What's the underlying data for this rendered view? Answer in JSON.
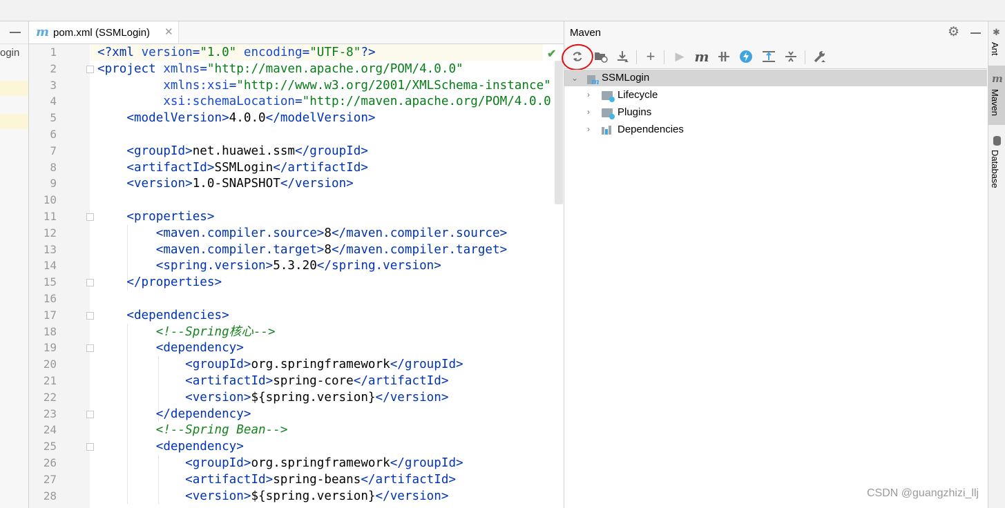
{
  "project": {
    "label": "ogin"
  },
  "tab": {
    "icon": "m",
    "title": "pom.xml (SSMLogin)",
    "close": "✕"
  },
  "line_numbers": [
    "1",
    "2",
    "3",
    "4",
    "5",
    "6",
    "7",
    "8",
    "9",
    "10",
    "11",
    "12",
    "13",
    "14",
    "15",
    "16",
    "17",
    "18",
    "19",
    "20",
    "21",
    "22",
    "23",
    "24",
    "25",
    "26",
    "27",
    "28"
  ],
  "maven": {
    "title": "Maven",
    "toolbar": [
      "reload-icon",
      "generate-sources-icon",
      "download-icon",
      "add-icon",
      "run-icon",
      "execute-goal-icon",
      "toggle-offline-icon",
      "skip-tests-icon",
      "show-dependencies-icon",
      "collapse-all-icon",
      "settings-wrench-icon"
    ],
    "tree": {
      "root": "SSMLogin",
      "children": [
        "Lifecycle",
        "Plugins",
        "Dependencies"
      ]
    }
  },
  "right_stripe": {
    "ant": "Ant",
    "maven": "Maven",
    "database": "Database"
  },
  "watermark": "CSDN @guangzhizi_llj",
  "colors": {
    "tag": "#0033b3",
    "string": "#067d17",
    "comment": "#15841e",
    "accent": "#5ba9e4"
  },
  "code_lines": [
    [
      [
        "t",
        "<?xml "
      ],
      [
        "a",
        "version"
      ],
      [
        "t",
        "="
      ],
      [
        "s",
        "\"1.0\""
      ],
      [
        "t",
        " "
      ],
      [
        "a",
        "encoding"
      ],
      [
        "t",
        "="
      ],
      [
        "s",
        "\"UTF-8\""
      ],
      [
        "t",
        "?>"
      ]
    ],
    [
      [
        "t",
        "<project "
      ],
      [
        "a",
        "xmlns"
      ],
      [
        "t",
        "="
      ],
      [
        "s",
        "\"http://maven.apache.org/POM/4.0.0\""
      ]
    ],
    [
      [
        "x",
        "         "
      ],
      [
        "a",
        "xmlns:xsi"
      ],
      [
        "t",
        "="
      ],
      [
        "s",
        "\"http://www.w3.org/2001/XMLSchema-instance\""
      ]
    ],
    [
      [
        "x",
        "         "
      ],
      [
        "a",
        "xsi:schemaLocation"
      ],
      [
        "t",
        "="
      ],
      [
        "s",
        "\"http://maven.apache.org/POM/4.0.0"
      ]
    ],
    [
      [
        "x",
        "    "
      ],
      [
        "t",
        "<modelVersion>"
      ],
      [
        "x",
        "4.0.0"
      ],
      [
        "t",
        "</modelVersion>"
      ]
    ],
    [
      [
        "x",
        ""
      ]
    ],
    [
      [
        "x",
        "    "
      ],
      [
        "t",
        "<groupId>"
      ],
      [
        "x",
        "net.huawei.ssm"
      ],
      [
        "t",
        "</groupId>"
      ]
    ],
    [
      [
        "x",
        "    "
      ],
      [
        "t",
        "<artifactId>"
      ],
      [
        "x",
        "SSMLogin"
      ],
      [
        "t",
        "</artifactId>"
      ]
    ],
    [
      [
        "x",
        "    "
      ],
      [
        "t",
        "<version>"
      ],
      [
        "x",
        "1.0-SNAPSHOT"
      ],
      [
        "t",
        "</version>"
      ]
    ],
    [
      [
        "x",
        ""
      ]
    ],
    [
      [
        "x",
        "    "
      ],
      [
        "t",
        "<properties>"
      ]
    ],
    [
      [
        "x",
        "        "
      ],
      [
        "t",
        "<maven.compiler.source>"
      ],
      [
        "x",
        "8"
      ],
      [
        "t",
        "</maven.compiler.source>"
      ]
    ],
    [
      [
        "x",
        "        "
      ],
      [
        "t",
        "<maven.compiler.target>"
      ],
      [
        "x",
        "8"
      ],
      [
        "t",
        "</maven.compiler.target>"
      ]
    ],
    [
      [
        "x",
        "        "
      ],
      [
        "t",
        "<spring.version>"
      ],
      [
        "x",
        "5.3.20"
      ],
      [
        "t",
        "</spring.version>"
      ]
    ],
    [
      [
        "x",
        "    "
      ],
      [
        "t",
        "</properties>"
      ]
    ],
    [
      [
        "x",
        ""
      ]
    ],
    [
      [
        "x",
        "    "
      ],
      [
        "t",
        "<dependencies>"
      ]
    ],
    [
      [
        "x",
        "        "
      ],
      [
        "c",
        "<!--Spring核心-->"
      ]
    ],
    [
      [
        "x",
        "        "
      ],
      [
        "t",
        "<dependency>"
      ]
    ],
    [
      [
        "x",
        "            "
      ],
      [
        "t",
        "<groupId>"
      ],
      [
        "x",
        "org.springframework"
      ],
      [
        "t",
        "</groupId>"
      ]
    ],
    [
      [
        "x",
        "            "
      ],
      [
        "t",
        "<artifactId>"
      ],
      [
        "x",
        "spring-core"
      ],
      [
        "t",
        "</artifactId>"
      ]
    ],
    [
      [
        "x",
        "            "
      ],
      [
        "t",
        "<version>"
      ],
      [
        "x",
        "${spring.version}"
      ],
      [
        "t",
        "</version>"
      ]
    ],
    [
      [
        "x",
        "        "
      ],
      [
        "t",
        "</dependency>"
      ]
    ],
    [
      [
        "x",
        "        "
      ],
      [
        "c",
        "<!--Spring Bean-->"
      ]
    ],
    [
      [
        "x",
        "        "
      ],
      [
        "t",
        "<dependency>"
      ]
    ],
    [
      [
        "x",
        "            "
      ],
      [
        "t",
        "<groupId>"
      ],
      [
        "x",
        "org.springframework"
      ],
      [
        "t",
        "</groupId>"
      ]
    ],
    [
      [
        "x",
        "            "
      ],
      [
        "t",
        "<artifactId>"
      ],
      [
        "x",
        "spring-beans"
      ],
      [
        "t",
        "</artifactId>"
      ]
    ],
    [
      [
        "x",
        "            "
      ],
      [
        "t",
        "<version>"
      ],
      [
        "x",
        "${spring.version}"
      ],
      [
        "t",
        "</version>"
      ]
    ]
  ]
}
